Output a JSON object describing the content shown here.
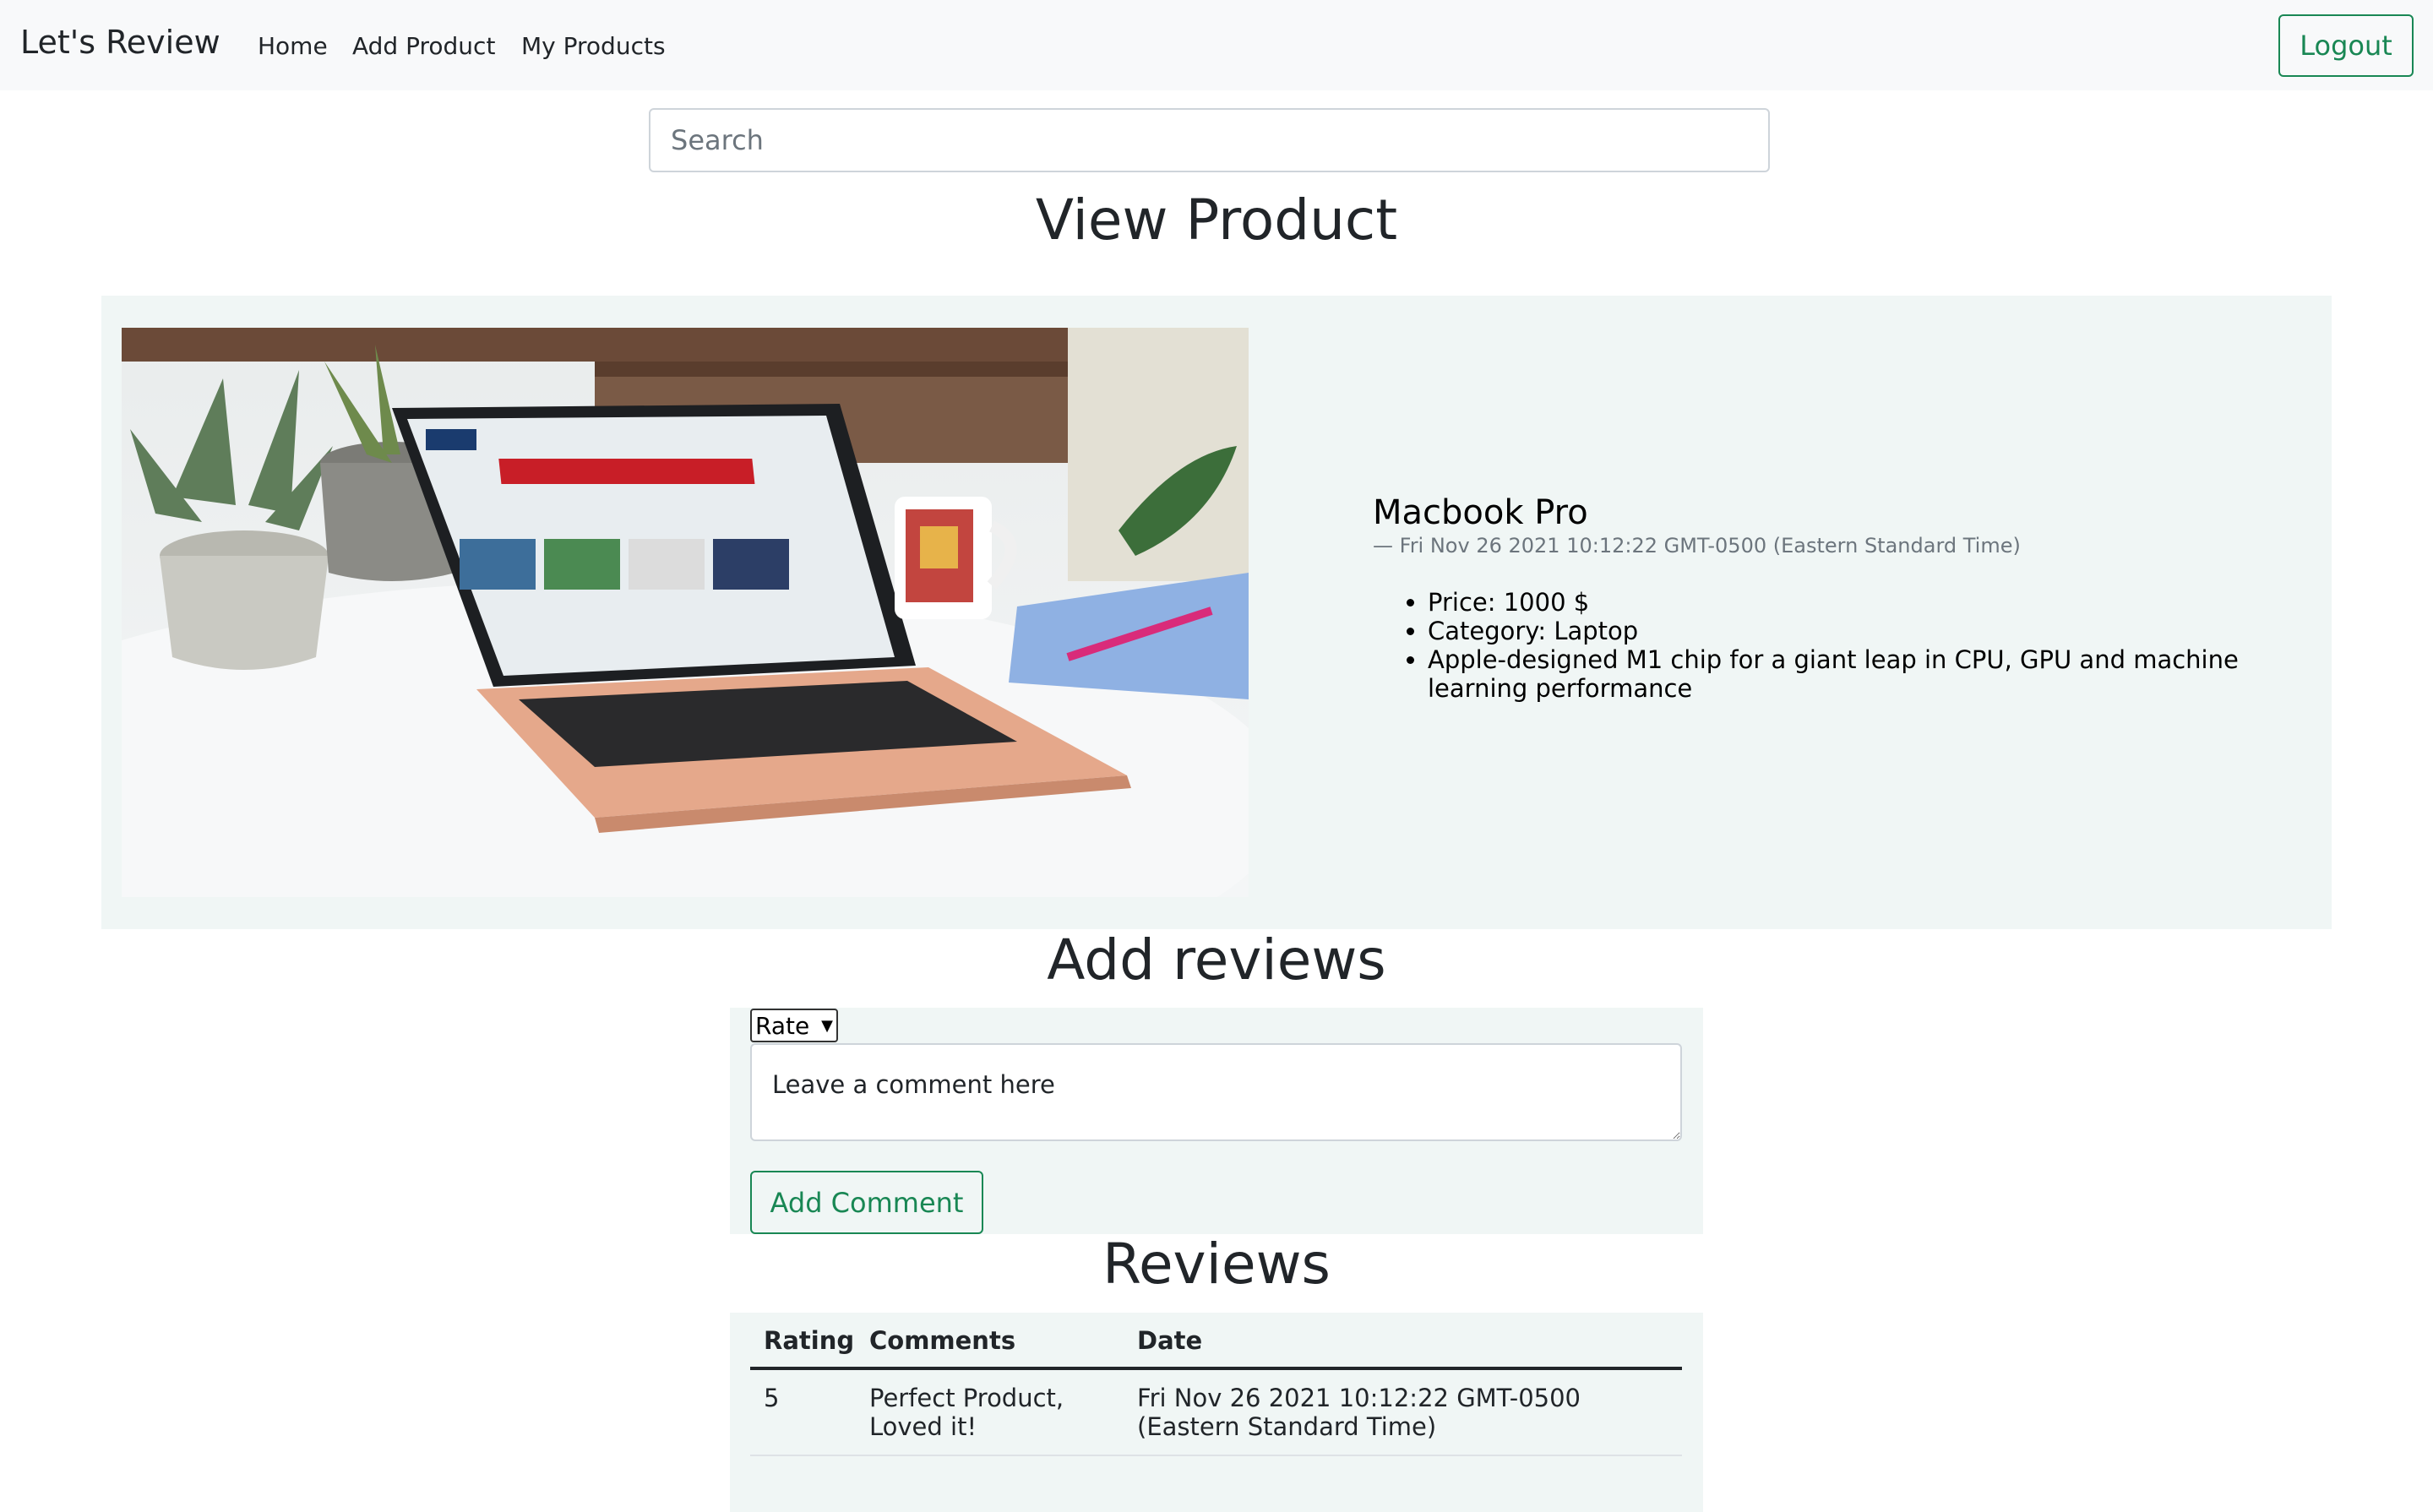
{
  "navbar": {
    "brand": "Let's Review",
    "links": [
      "Home",
      "Add Product",
      "My Products"
    ],
    "logout_label": "Logout"
  },
  "search": {
    "placeholder": "Search",
    "value": ""
  },
  "view_product": {
    "heading": "View Product",
    "image_icon": "laptop-photo",
    "name": "Macbook Pro",
    "date": "—  Fri Nov 26 2021 10:12:22 GMT-0500 (Eastern Standard Time)",
    "details": [
      "Price: 1000 $",
      "Category: Laptop",
      "Apple-designed M1 chip for a giant leap in CPU, GPU and machine learning performance"
    ]
  },
  "add_reviews": {
    "heading": "Add reviews",
    "rate_selected": "Rate",
    "comment_placeholder": "Leave a comment here",
    "comment_value": "",
    "add_button_label": "Add Comment"
  },
  "reviews": {
    "heading": "Reviews",
    "columns": [
      "Rating",
      "Comments",
      "Date"
    ],
    "rows": [
      {
        "rating": "5",
        "comment": "Perfect Product, Loved it!",
        "date": "Fri Nov 26 2021 10:12:22 GMT-0500 (Eastern Standard Time)"
      }
    ]
  },
  "colors": {
    "accent": "#198754",
    "navbar_bg": "#f8f9fa",
    "panel_bg": "#f0f6f5"
  }
}
